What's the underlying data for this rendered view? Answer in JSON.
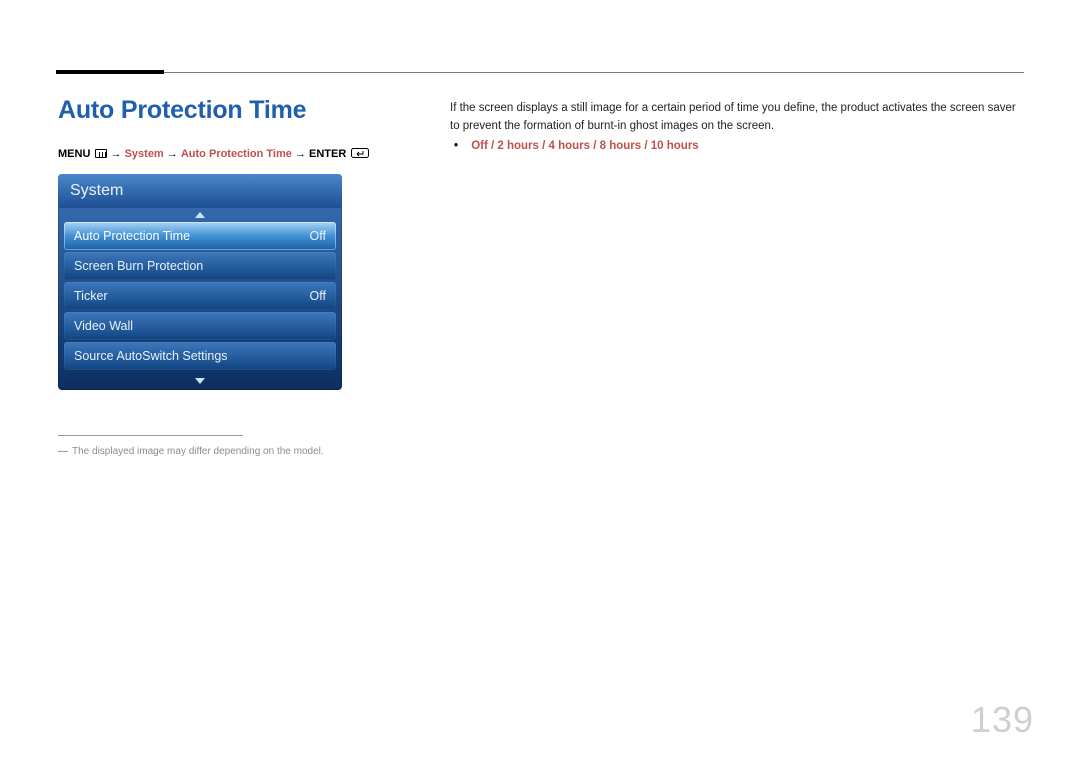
{
  "pageTitle": "Auto Protection Time",
  "breadcrumb": {
    "menu": "MENU",
    "arrow": "→",
    "system": "System",
    "item": "Auto Protection Time",
    "enter": "ENTER"
  },
  "osd": {
    "header": "System",
    "items": [
      {
        "label": "Auto Protection Time",
        "value": "Off",
        "selected": true
      },
      {
        "label": "Screen Burn Protection",
        "value": "",
        "selected": false
      },
      {
        "label": "Ticker",
        "value": "Off",
        "selected": false
      },
      {
        "label": "Video Wall",
        "value": "",
        "selected": false
      },
      {
        "label": "Source AutoSwitch Settings",
        "value": "",
        "selected": false
      }
    ]
  },
  "note": "The displayed image may differ depending on the model.",
  "description": "If the screen displays a still image for a certain period of time you define, the product activates the screen saver to prevent the formation of burnt-in ghost images on the screen.",
  "options": "Off / 2 hours / 4 hours / 8 hours / 10 hours",
  "pageNumber": "139"
}
